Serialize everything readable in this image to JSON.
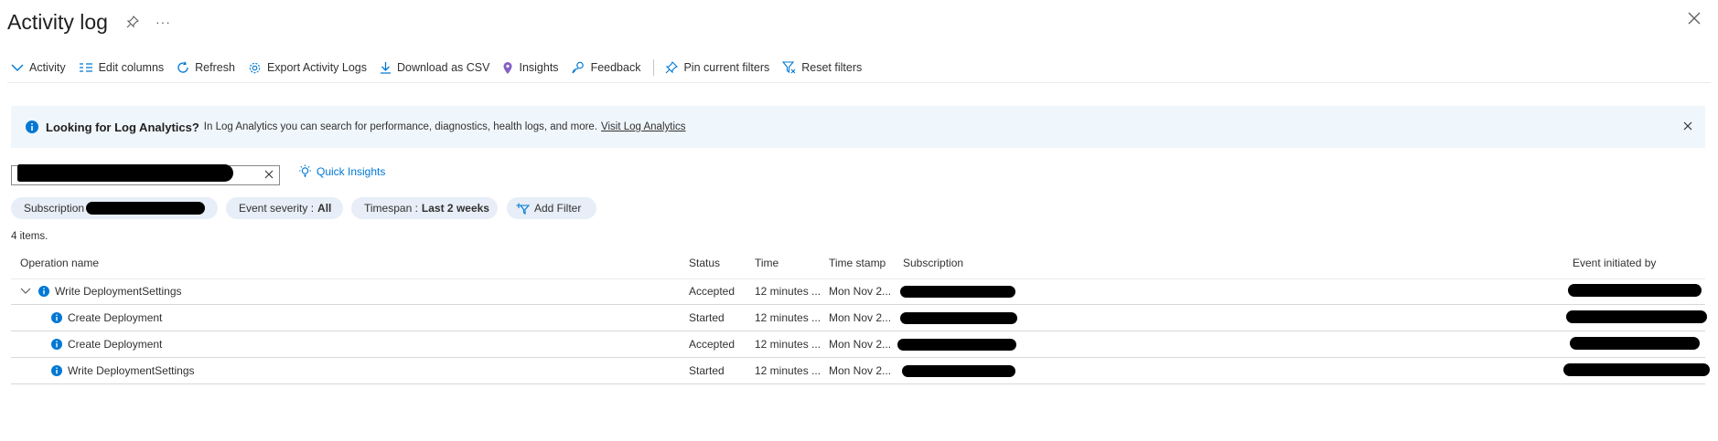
{
  "header": {
    "title": "Activity log",
    "more_label": "···"
  },
  "toolbar": {
    "activity": "Activity",
    "edit_columns": "Edit columns",
    "refresh": "Refresh",
    "export": "Export Activity Logs",
    "download": "Download as CSV",
    "insights": "Insights",
    "feedback": "Feedback",
    "pin_filters": "Pin current filters",
    "reset_filters": "Reset filters"
  },
  "banner": {
    "strong": "Looking for Log Analytics?",
    "text": "In Log Analytics you can search for performance, diagnostics, health logs, and more.",
    "link": "Visit Log Analytics"
  },
  "search": {
    "value": ""
  },
  "quick_insights": "Quick Insights",
  "filters": {
    "subscription_label": "Subscription",
    "severity_label": "Event severity :",
    "severity_value": "All",
    "timespan_label": "Timespan :",
    "timespan_value": "Last 2 weeks",
    "add_filter": "Add Filter"
  },
  "count_text": "4 items.",
  "columns": {
    "operation": "Operation name",
    "status": "Status",
    "time": "Time",
    "timestamp": "Time stamp",
    "subscription": "Subscription",
    "initiated_by": "Event initiated by"
  },
  "rows": [
    {
      "operation": "Write DeploymentSettings",
      "status": "Accepted",
      "time": "12 minutes ...",
      "timestamp": "Mon Nov 2..."
    },
    {
      "operation": "Create Deployment",
      "status": "Started",
      "time": "12 minutes ...",
      "timestamp": "Mon Nov 2..."
    },
    {
      "operation": "Create Deployment",
      "status": "Accepted",
      "time": "12 minutes ...",
      "timestamp": "Mon Nov 2..."
    },
    {
      "operation": "Write DeploymentSettings",
      "status": "Started",
      "time": "12 minutes ...",
      "timestamp": "Mon Nov 2..."
    }
  ],
  "colors": {
    "accent": "#0078d4",
    "banner_bg": "#eff6fc",
    "pill_bg": "#e7eef7",
    "insights_icon": "#8661c5"
  },
  "icons": [
    "pin-icon",
    "close-icon",
    "chevron-down-icon",
    "columns-icon",
    "refresh-icon",
    "gear-icon",
    "download-icon",
    "lightbulb-pin-icon",
    "feedback-icon",
    "filter-icon",
    "info-icon",
    "search-icon"
  ]
}
